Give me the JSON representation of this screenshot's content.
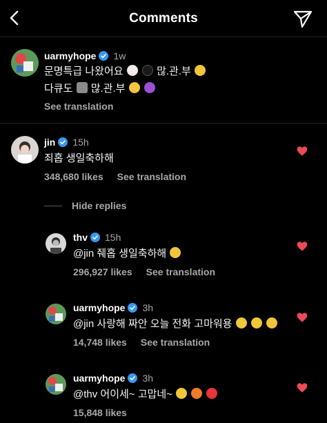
{
  "header": {
    "title": "Comments"
  },
  "caption": {
    "username": "uarmyhope",
    "time": "1w",
    "line1": "문명특급 나왔어요",
    "line1_suffix": "많.관.부",
    "line2": "다큐도",
    "line2_suffix": "많.관.부",
    "see_translation": "See translation"
  },
  "comment_jin": {
    "username": "jin",
    "time": "15h",
    "text": "죄홉 생일축하해",
    "likes": "348,680 likes",
    "see_translation": "See translation"
  },
  "hide_replies": "Hide replies",
  "replies": [
    {
      "username": "thv",
      "time": "15h",
      "text": "@jin 줴홉 생일축하해",
      "likes": "296,927 likes",
      "see_translation": "See translation"
    },
    {
      "username": "uarmyhope",
      "time": "3h",
      "text": "@jin 사랑해 짜안 오늘 전화 고마워용",
      "likes": "14,748 likes",
      "see_translation": "See translation"
    },
    {
      "username": "uarmyhope",
      "time": "3h",
      "text": "@thv 어이세~ 고맙네~",
      "likes": "15,848 likes"
    }
  ],
  "colors": {
    "heart": "#ed4956",
    "verified": "#3897f0",
    "muted": "#a8a8a8",
    "divider": "#262626"
  },
  "icons": [
    "back-arrow-icon",
    "send-icon",
    "verified-badge-icon",
    "heart-icon"
  ]
}
